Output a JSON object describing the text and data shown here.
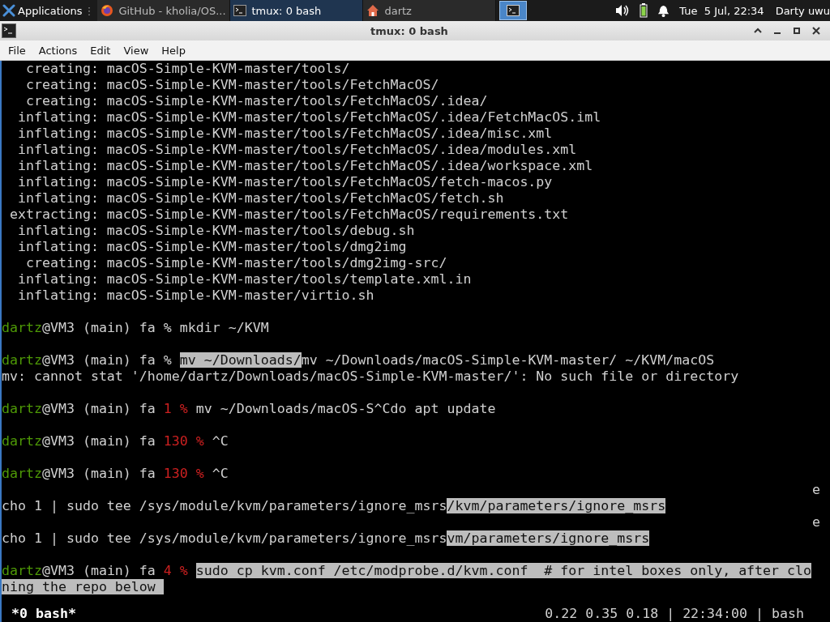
{
  "taskbar": {
    "menu_label": "Applications",
    "separator": "⋮",
    "tasks": [
      {
        "label": "GitHub - kholia/OS...",
        "selected": false
      },
      {
        "label": "tmux: 0 bash",
        "selected": true
      },
      {
        "label": "dartz",
        "selected": false
      }
    ],
    "workspace": {
      "selected": true
    },
    "clock": "Tue  5 Jul, 22:34",
    "user": "Darty uwu"
  },
  "window": {
    "title": "tmux: 0 bash"
  },
  "menu": [
    "File",
    "Actions",
    "Edit",
    "View",
    "Help"
  ],
  "terminal": {
    "lines": [
      {
        "kind": "output",
        "segments": [
          {
            "kind": "text",
            "text": "   creating: macOS-Simple-KVM-master/tools/"
          }
        ]
      },
      {
        "kind": "output",
        "segments": [
          {
            "kind": "text",
            "text": "   creating: macOS-Simple-KVM-master/tools/FetchMacOS/"
          }
        ]
      },
      {
        "kind": "output",
        "segments": [
          {
            "kind": "text",
            "text": "   creating: macOS-Simple-KVM-master/tools/FetchMacOS/.idea/"
          }
        ]
      },
      {
        "kind": "output",
        "segments": [
          {
            "kind": "text",
            "text": "  inflating: macOS-Simple-KVM-master/tools/FetchMacOS/.idea/FetchMacOS.iml"
          }
        ]
      },
      {
        "kind": "output",
        "segments": [
          {
            "kind": "text",
            "text": "  inflating: macOS-Simple-KVM-master/tools/FetchMacOS/.idea/misc.xml"
          }
        ]
      },
      {
        "kind": "output",
        "segments": [
          {
            "kind": "text",
            "text": "  inflating: macOS-Simple-KVM-master/tools/FetchMacOS/.idea/modules.xml"
          }
        ]
      },
      {
        "kind": "output",
        "segments": [
          {
            "kind": "text",
            "text": "  inflating: macOS-Simple-KVM-master/tools/FetchMacOS/.idea/workspace.xml"
          }
        ]
      },
      {
        "kind": "output",
        "segments": [
          {
            "kind": "text",
            "text": "  inflating: macOS-Simple-KVM-master/tools/FetchMacOS/fetch-macos.py"
          }
        ]
      },
      {
        "kind": "output",
        "segments": [
          {
            "kind": "text",
            "text": "  inflating: macOS-Simple-KVM-master/tools/FetchMacOS/fetch.sh"
          }
        ]
      },
      {
        "kind": "output",
        "segments": [
          {
            "kind": "text",
            "text": " extracting: macOS-Simple-KVM-master/tools/FetchMacOS/requirements.txt"
          }
        ]
      },
      {
        "kind": "output",
        "segments": [
          {
            "kind": "text",
            "text": "  inflating: macOS-Simple-KVM-master/tools/debug.sh"
          }
        ]
      },
      {
        "kind": "output",
        "segments": [
          {
            "kind": "text",
            "text": "  inflating: macOS-Simple-KVM-master/tools/dmg2img"
          }
        ]
      },
      {
        "kind": "output",
        "segments": [
          {
            "kind": "text",
            "text": "   creating: macOS-Simple-KVM-master/tools/dmg2img-src/"
          }
        ]
      },
      {
        "kind": "output",
        "segments": [
          {
            "kind": "text",
            "text": "  inflating: macOS-Simple-KVM-master/tools/template.xml.in"
          }
        ]
      },
      {
        "kind": "output",
        "segments": [
          {
            "kind": "text",
            "text": "  inflating: macOS-Simple-KVM-master/virtio.sh"
          }
        ]
      },
      {
        "kind": "blank"
      },
      {
        "kind": "output",
        "segments": [
          {
            "kind": "user",
            "text": "dartz"
          },
          {
            "kind": "text",
            "text": "@VM3 (main) fa % mkdir ~/KVM"
          }
        ]
      },
      {
        "kind": "blank"
      },
      {
        "kind": "output",
        "segments": [
          {
            "kind": "user",
            "text": "dartz"
          },
          {
            "kind": "text",
            "text": "@VM3 (main) fa % "
          },
          {
            "kind": "selection",
            "text": "mv ~/Downloads/"
          },
          {
            "kind": "text",
            "text": "mv ~/Downloads/macOS-Simple-KVM-master/ ~/KVM/macOS"
          }
        ]
      },
      {
        "kind": "output",
        "segments": [
          {
            "kind": "text",
            "text": "mv: cannot stat '/home/dartz/Downloads/macOS-Simple-KVM-master/': No such file or directory"
          }
        ]
      },
      {
        "kind": "blank"
      },
      {
        "kind": "output",
        "segments": [
          {
            "kind": "user",
            "text": "dartz"
          },
          {
            "kind": "text",
            "text": "@VM3 (main) fa "
          },
          {
            "kind": "error",
            "text": "1 %"
          },
          {
            "kind": "text",
            "text": " mv ~/Downloads/macOS-S^Cdo apt update"
          }
        ]
      },
      {
        "kind": "blank"
      },
      {
        "kind": "output",
        "segments": [
          {
            "kind": "user",
            "text": "dartz"
          },
          {
            "kind": "text",
            "text": "@VM3 (main) fa "
          },
          {
            "kind": "error",
            "text": "130 %"
          },
          {
            "kind": "text",
            "text": " ^C"
          }
        ]
      },
      {
        "kind": "blank"
      },
      {
        "kind": "output",
        "segments": [
          {
            "kind": "user",
            "text": "dartz"
          },
          {
            "kind": "text",
            "text": "@VM3 (main) fa "
          },
          {
            "kind": "error",
            "text": "130 %"
          },
          {
            "kind": "text",
            "text": " ^C"
          }
        ]
      },
      {
        "kind": "right",
        "segments": [
          {
            "kind": "text",
            "text": "e"
          }
        ]
      },
      {
        "kind": "output",
        "segments": [
          {
            "kind": "text",
            "text": "cho 1 | sudo tee /sys/module/kvm/parameters/ignore_msrs"
          },
          {
            "kind": "selection",
            "text": "/kvm/parameters/ignore_msrs"
          }
        ]
      },
      {
        "kind": "right",
        "segments": [
          {
            "kind": "text",
            "text": "e"
          }
        ]
      },
      {
        "kind": "output",
        "segments": [
          {
            "kind": "text",
            "text": "cho 1 | sudo tee /sys/module/kvm/parameters/ignore_msrs"
          },
          {
            "kind": "selection",
            "text": "vm/parameters/ignore_msrs"
          }
        ]
      },
      {
        "kind": "blank"
      },
      {
        "kind": "output",
        "segments": [
          {
            "kind": "user",
            "text": "dartz"
          },
          {
            "kind": "text",
            "text": "@VM3 (main) fa "
          },
          {
            "kind": "error",
            "text": "4 % "
          },
          {
            "kind": "selection",
            "text": "sudo cp kvm.conf /etc/modprobe.d/kvm.conf  # for intel boxes only, after clo"
          }
        ]
      },
      {
        "kind": "output",
        "segments": [
          {
            "kind": "selection",
            "text": "ning the repo below "
          }
        ]
      }
    ],
    "status_left": "*0 bash*",
    "status_right": "0.22 0.35 0.18 | 22:34:00 | bash"
  }
}
